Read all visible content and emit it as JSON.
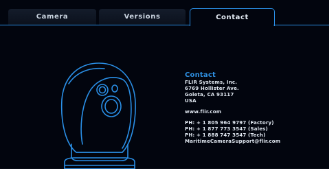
{
  "tabs": {
    "camera": "Camera",
    "versions": "Versions",
    "contact": "Contact"
  },
  "contact": {
    "title": "Contact",
    "address": [
      "FLIR Systems, Inc.",
      "6769 Hollister Ave.",
      "Goleta, CA 93117",
      "USA"
    ],
    "website": "www.flir.com",
    "phones": [
      "PH: + 1 805 964 9797 (Factory)",
      "PH: + 1 877 773 3547 (Sales)",
      "PH: + 1 888 747 3547 (Tech)"
    ],
    "email": "MaritimeCameraSupport@flir.com"
  },
  "colors": {
    "background": "#02050e",
    "accent": "#2a8fe6",
    "text": "#e2e9f2"
  },
  "icons": {
    "camera_illustration": "thermal-camera-icon"
  }
}
